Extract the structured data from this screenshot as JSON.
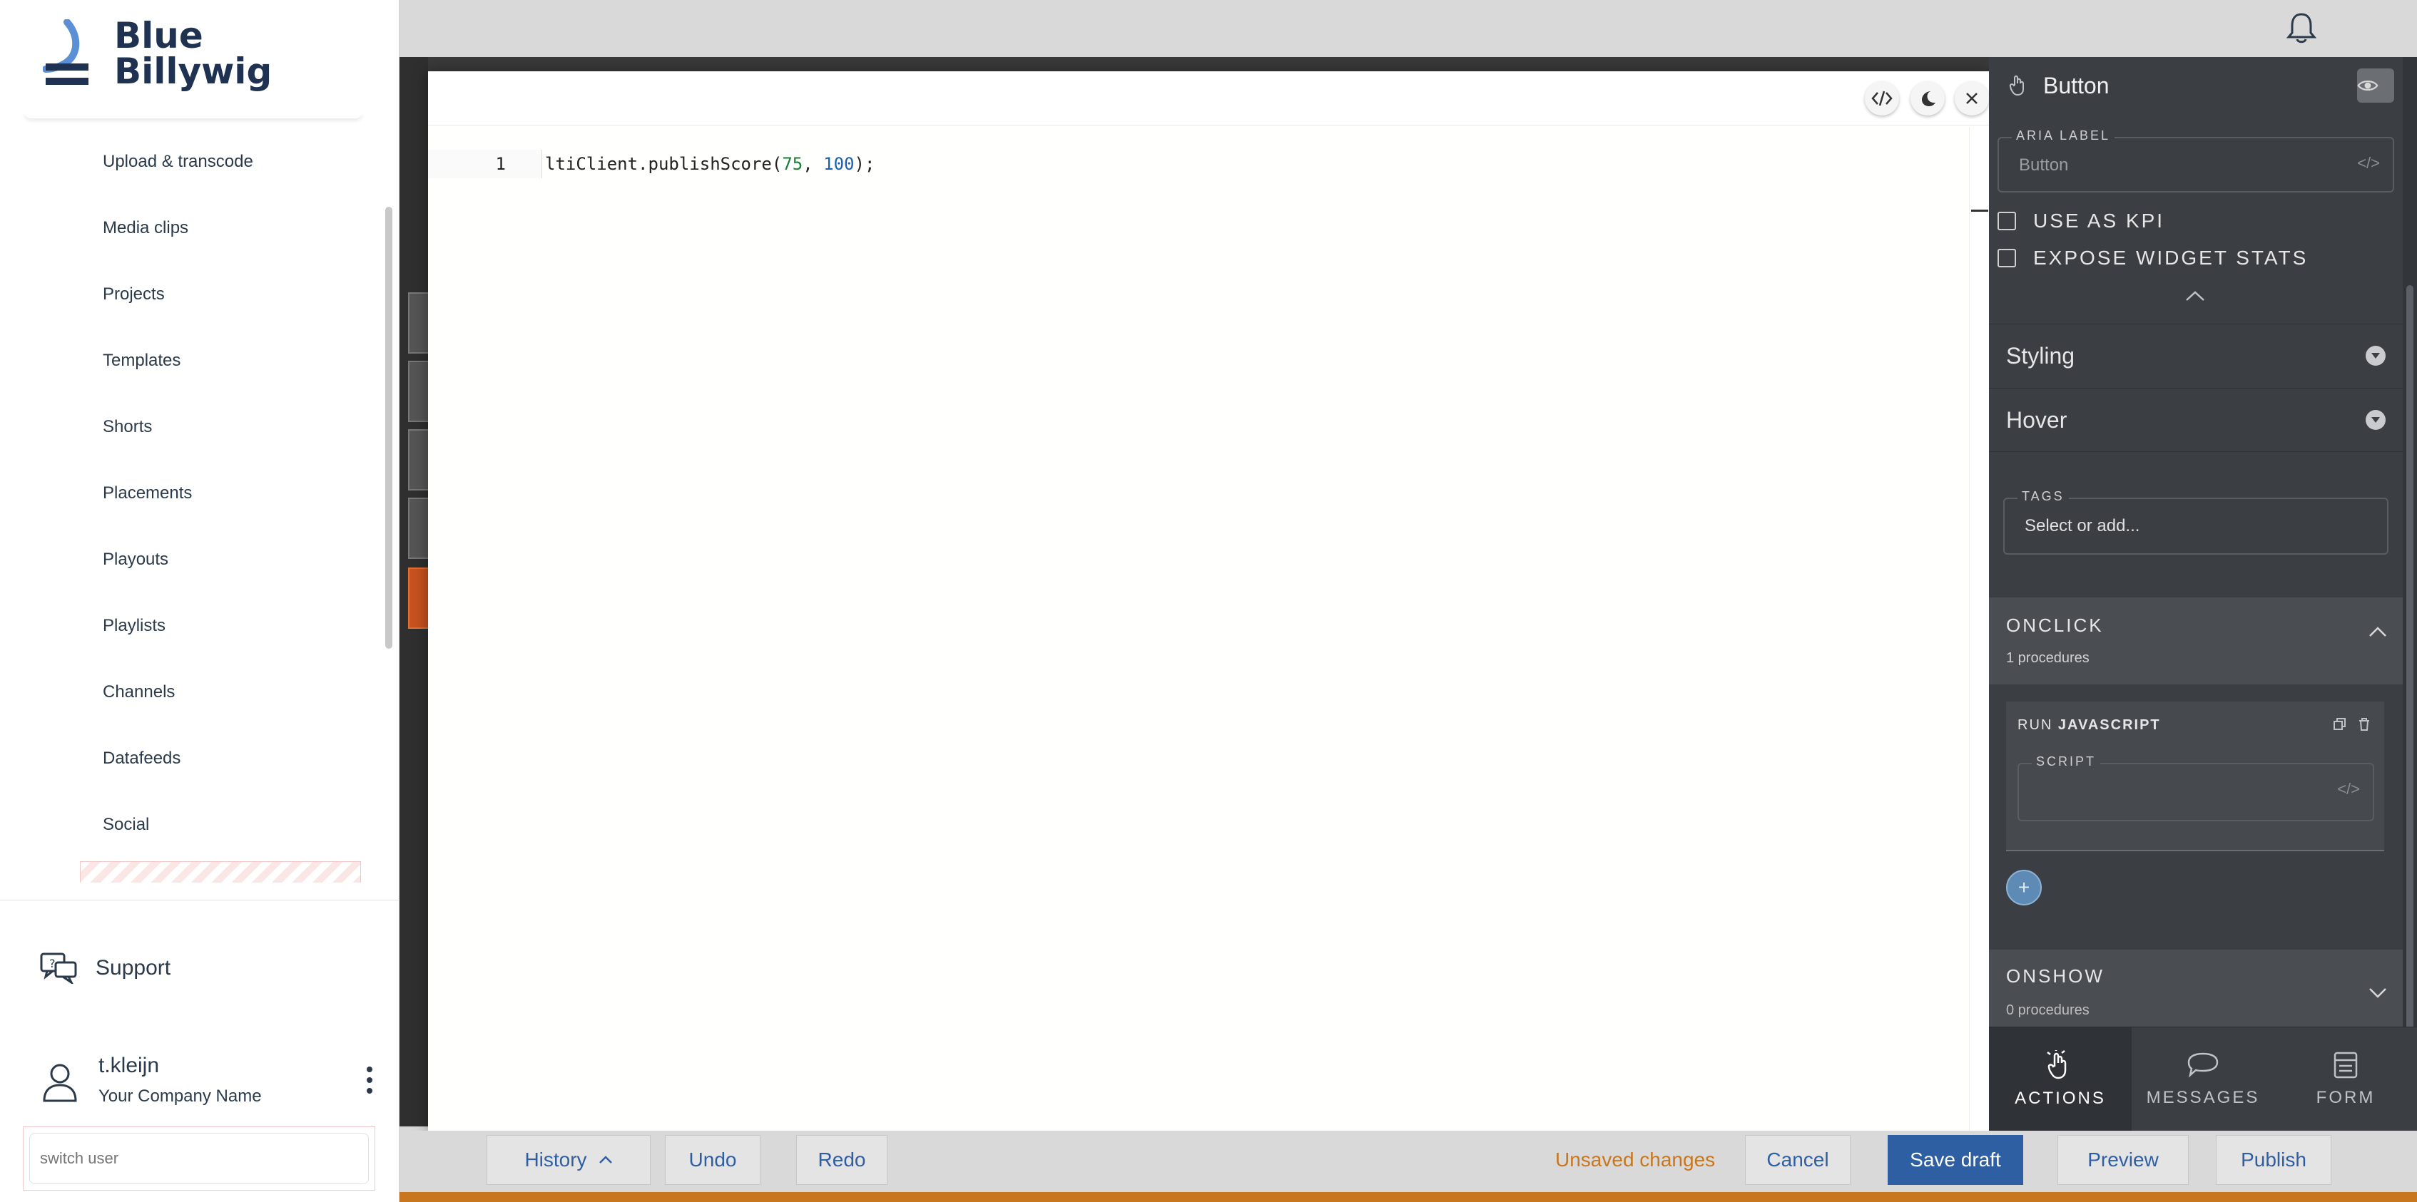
{
  "brand": {
    "line1": "Blue",
    "line2": "Billywig"
  },
  "nav": {
    "items": [
      "Upload & transcode",
      "Media clips",
      "Projects",
      "Templates",
      "Shorts",
      "Placements",
      "Playouts",
      "Playlists",
      "Channels",
      "Datafeeds",
      "Social"
    ],
    "support_label": "Support"
  },
  "user": {
    "name": "t.kleijn",
    "company": "Your Company Name",
    "switch_placeholder": "switch user"
  },
  "code_editor": {
    "line_number": "1",
    "code_prefix": "ltiClient.publishScore(",
    "arg1": "75",
    "separator": ", ",
    "arg2": "100",
    "code_suffix": ");"
  },
  "panel": {
    "title": "Button",
    "aria_label_legend": "ARIA LABEL",
    "aria_label_value": "Button",
    "use_as_kpi": "USE AS KPI",
    "expose_widget_stats": "EXPOSE WIDGET STATS",
    "styling": "Styling",
    "hover": "Hover",
    "tags_legend": "TAGS",
    "tags_placeholder": "Select or add...",
    "onclick_title": "ONCLICK",
    "onclick_sub": "1 procedures",
    "proc_run": "RUN",
    "proc_type": "JAVASCRIPT",
    "script_legend": "SCRIPT",
    "add_symbol": "+",
    "onshow_title": "ONSHOW",
    "onshow_sub": "0 procedures",
    "tabs": [
      "ACTIONS",
      "MESSAGES",
      "FORM"
    ]
  },
  "bottom": {
    "history": "History",
    "undo": "Undo",
    "redo": "Redo",
    "unsaved": "Unsaved changes",
    "cancel": "Cancel",
    "save_draft": "Save draft",
    "preview": "Preview",
    "publish": "Publish"
  },
  "colors": {
    "brand_navy": "#1f3251",
    "accent_blue": "#2f5fa3",
    "warning_orange": "#c8771f",
    "panel_dark": "#3b3f44"
  },
  "icons": [
    "logo-mark-icon",
    "support-icon",
    "user-icon",
    "kebab-menu-icon",
    "bell-icon",
    "code-icon",
    "moon-icon",
    "close-icon",
    "hand-icon",
    "eye-icon",
    "chevron-up-icon",
    "chevron-down-icon",
    "copy-icon",
    "trash-icon",
    "chat-icon",
    "form-icon"
  ]
}
